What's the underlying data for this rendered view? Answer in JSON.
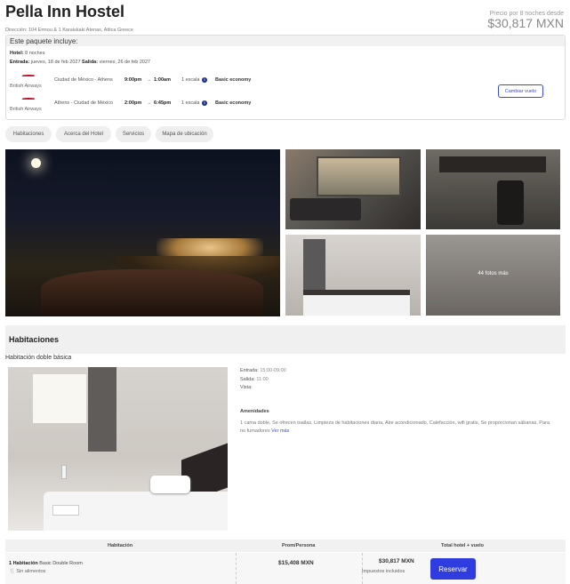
{
  "hotel": {
    "name": "Pella Inn Hostel",
    "address": "Dirección: 104 Ermou & 1 Karaiskaki Atenas, Attica Greece",
    "price_label": "Precio por 8 noches desde",
    "price_total": "$30,817 MXN"
  },
  "package": {
    "heading": "Este paquete incluye:",
    "hotel_label": "Hotel:",
    "hotel_value": "8 noches",
    "checkin_label": "Entrada:",
    "checkin_value": "jueves, 18 de feb 2027",
    "checkout_label": "Salida:",
    "checkout_value": "viernes, 26 de feb 2027",
    "change_flight_label": "Cambiar vuelo",
    "flights": [
      {
        "airline": "British Airways",
        "route": "Ciudad de México - Athens",
        "depart": "9:00pm",
        "arrive": "1:00am",
        "dash": "→",
        "stops": "1 escala",
        "info_icon": "i",
        "cabin": "Basic economy"
      },
      {
        "airline": "British Airways",
        "route": "Athens - Ciudad de México",
        "depart": "2:00pm",
        "arrive": "6:45pm",
        "dash": "→",
        "stops": "1 escala",
        "info_icon": "i",
        "cabin": "Basic economy"
      }
    ]
  },
  "tabs": [
    "Habitaciones",
    "Acerca del Hotel",
    "Servicios",
    "Mapa de ubicación"
  ],
  "gallery": {
    "more_photos": "44 fotos más"
  },
  "rooms_section": {
    "title": "Habitaciones",
    "room_type": "Habitación doble básica",
    "checkin_label": "Entrada:",
    "checkin_value": "15:00-09:00",
    "checkout_label": "Salida:",
    "checkout_value": "11:00",
    "view_label": "Vista:",
    "view_value": "",
    "amenities_title": "Amenidades",
    "amenities_text": "1 cama doble, Se ofrecen toallas, Limpieza de habitaciones diaria, Aire acondicionado, Calefacción, wifi gratis, Se proporcionan sábanas, Para no fumadores",
    "see_more": "Ver más"
  },
  "rates_table": {
    "headers": [
      "Habitación",
      "Prom/Persona",
      "Total hotel + vuelo"
    ],
    "row": {
      "room_count": "1 Habitación",
      "room_name": "Basic Double Room",
      "meal_icon": "🍴",
      "meal": "Sin alimentos",
      "per_person": "$15,408 MXN",
      "total": "$30,817 MXN",
      "tax_note": "Impuestos incluidos",
      "reserve_label": "Reservar"
    }
  },
  "colors": {
    "accent": "#2f3ce0",
    "airline_red": "#c8102e",
    "info_blue": "#1a2b8c"
  }
}
